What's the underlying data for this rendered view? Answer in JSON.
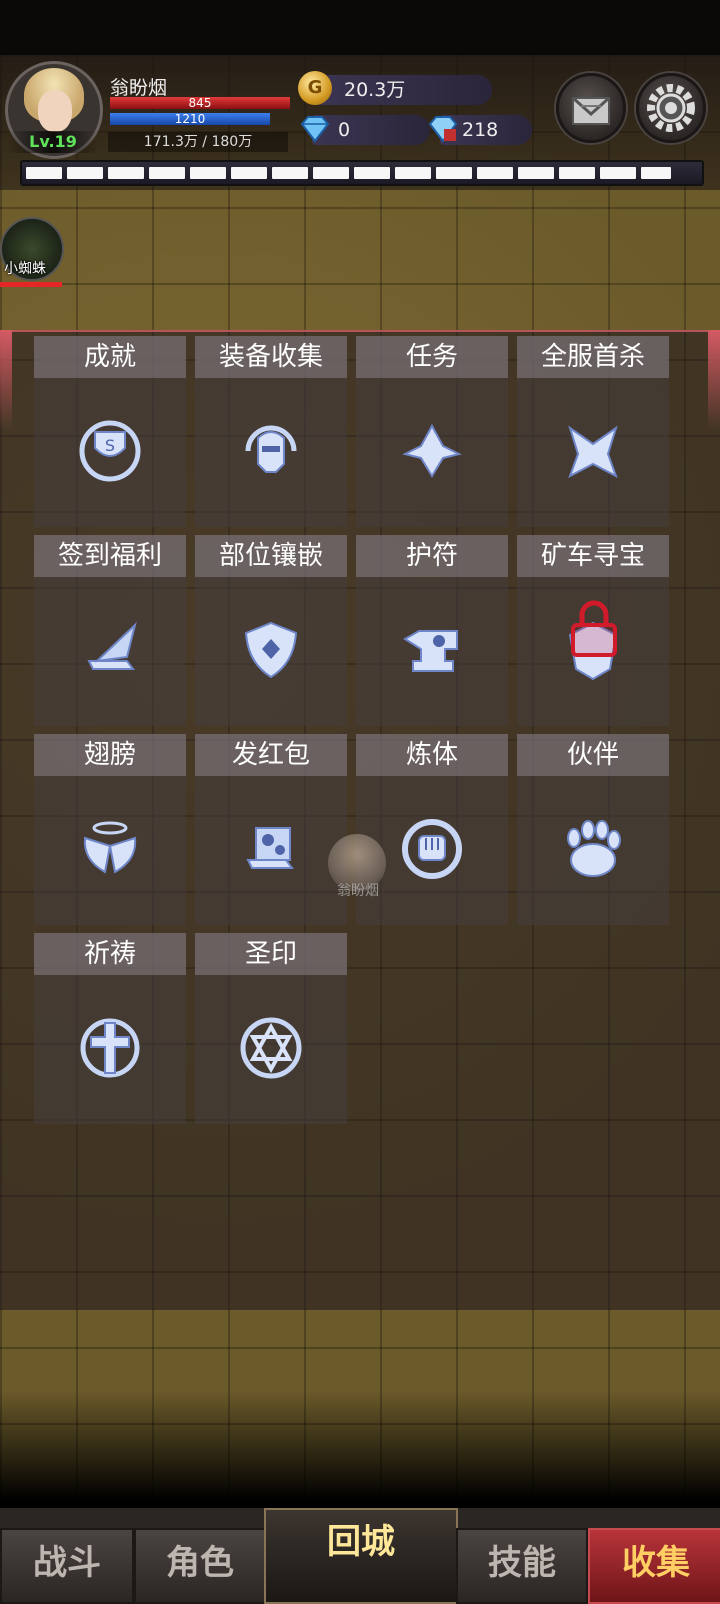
{
  "player": {
    "name": "翁盼烟",
    "level": "Lv.19",
    "hp": "845",
    "mp": "1210",
    "exp": "171.3万 / 180万"
  },
  "resources": {
    "gold": "20.3万",
    "diamonds": "0",
    "bound_diamonds": "218"
  },
  "monster": {
    "name": "小蜘蛛"
  },
  "map_marker": {
    "name": "翁盼烟"
  },
  "menu": [
    {
      "label": "成就",
      "icon": "trophy-icon"
    },
    {
      "label": "装备收集",
      "icon": "helmet-icon"
    },
    {
      "label": "任务",
      "icon": "quest-icon"
    },
    {
      "label": "全服首杀",
      "icon": "first-kill-icon"
    },
    {
      "label": "签到福利",
      "icon": "scroll-wing-icon"
    },
    {
      "label": "部位镶嵌",
      "icon": "shield-gem-icon"
    },
    {
      "label": "护符",
      "icon": "anvil-icon"
    },
    {
      "label": "矿车寻宝",
      "icon": "mine-cart-icon",
      "locked": true
    },
    {
      "label": "翅膀",
      "icon": "wings-icon"
    },
    {
      "label": "发红包",
      "icon": "red-packet-icon"
    },
    {
      "label": "炼体",
      "icon": "fist-icon"
    },
    {
      "label": "伙伴",
      "icon": "paw-icon"
    },
    {
      "label": "祈祷",
      "icon": "cross-icon"
    },
    {
      "label": "圣印",
      "icon": "star-seal-icon"
    }
  ],
  "nav": {
    "battle": "战斗",
    "character": "角色",
    "return_city": "回城",
    "skills": "技能",
    "collect": "收集"
  },
  "colors": {
    "active_tab": "#b8343a",
    "hp": "#e23a3a",
    "mp": "#3c7ff0",
    "level": "#5fe35a"
  }
}
